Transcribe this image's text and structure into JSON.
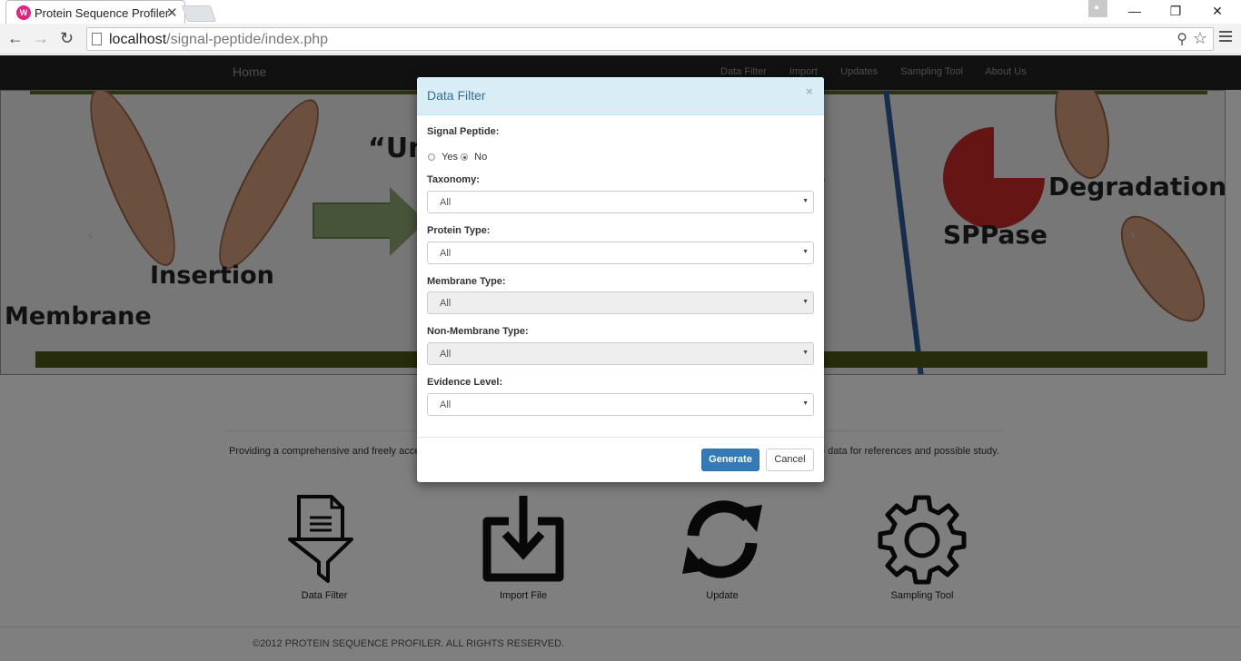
{
  "browser": {
    "tab_title": "Protein Sequence Profiler",
    "tab_close": "✕",
    "url_host": "localhost",
    "url_path": "/signal-peptide/index.php",
    "win_minimize": "—",
    "win_restore": "❐",
    "win_close": "✕"
  },
  "navbar": {
    "brand": "Home",
    "links": [
      "Data Filter",
      "Import",
      "Updates",
      "Sampling Tool",
      "About Us"
    ]
  },
  "carousel": {
    "words": {
      "unfold": "“Un",
      "insertion": "Insertion",
      "membrane": "Membrane",
      "degradation": "Degradation",
      "sppase": "SPPase",
      "quote_mark": "”"
    },
    "prev": "‹",
    "next": "›"
  },
  "description": {
    "left": "Providing a comprehensive and freely acces",
    "right": "e data for references and possible study."
  },
  "features": [
    {
      "label": "Data Filter",
      "icon": "filter-icon"
    },
    {
      "label": "Import File",
      "icon": "download-icon"
    },
    {
      "label": "Update",
      "icon": "refresh-icon"
    },
    {
      "label": "Sampling Tool",
      "icon": "gear-icon"
    }
  ],
  "footer": "©2012 PROTEIN SEQUENCE PROFILER. ALL RIGHTS RESERVED.",
  "modal": {
    "title": "Data Filter",
    "close": "×",
    "signal_peptide_label": "Signal Peptide:",
    "radio_yes": "Yes",
    "radio_no": "No",
    "selected_radio": "No",
    "fields": {
      "taxonomy": {
        "label": "Taxonomy:",
        "value": "All"
      },
      "protein_type": {
        "label": "Protein Type:",
        "value": "All"
      },
      "membrane_type": {
        "label": "Membrane Type:",
        "value": "All"
      },
      "non_membrane_type": {
        "label": "Non-Membrane Type:",
        "value": "All"
      },
      "evidence_level": {
        "label": "Evidence Level:",
        "value": "All"
      }
    },
    "generate": "Generate",
    "cancel": "Cancel"
  }
}
